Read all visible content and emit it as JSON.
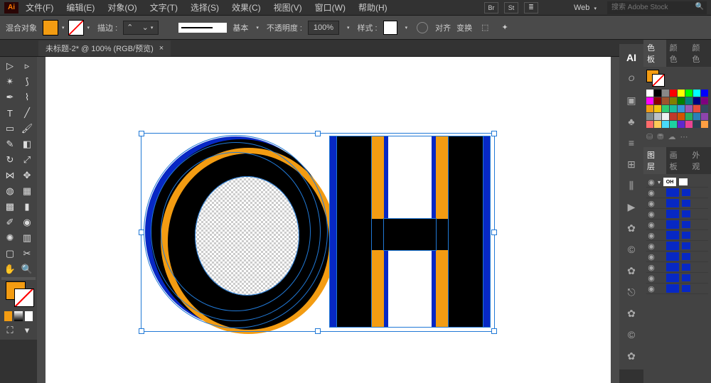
{
  "menubar": {
    "app": "Ai",
    "items": [
      "文件(F)",
      "编辑(E)",
      "对象(O)",
      "文字(T)",
      "选择(S)",
      "效果(C)",
      "视图(V)",
      "窗口(W)",
      "帮助(H)"
    ],
    "right_icons": [
      "Br",
      "St",
      "≣"
    ],
    "workspace": "Web",
    "search_placeholder": "搜索 Adobe Stock"
  },
  "controlbar": {
    "blend_label": "混合对象",
    "stroke_label": "描边 :",
    "basic_label": "基本",
    "opacity_label": "不透明度 :",
    "opacity_value": "100%",
    "style_label": "样式 :",
    "align": "对齐",
    "transform": "变换"
  },
  "document_tab": {
    "title": "未标题-2* @ 100% (RGB/预览)"
  },
  "panels": {
    "color_tabs": [
      "色板",
      "颜色",
      "颜色"
    ],
    "layer_tabs": [
      "图层",
      "画板",
      "外观"
    ],
    "layers": [
      {
        "thumb": "OH",
        "color": "#fff"
      },
      {
        "thumb": "",
        "color": "#0728c4"
      },
      {
        "thumb": "",
        "color": "#0728c4"
      },
      {
        "thumb": "",
        "color": "#0728c4"
      },
      {
        "thumb": "",
        "color": "#0728c4"
      },
      {
        "thumb": "",
        "color": "#0728c4"
      },
      {
        "thumb": "",
        "color": "#0728c4"
      },
      {
        "thumb": "",
        "color": "#0728c4"
      },
      {
        "thumb": "",
        "color": "#0728c4"
      },
      {
        "thumb": "",
        "color": "#0728c4"
      },
      {
        "thumb": "",
        "color": "#0728c4"
      }
    ]
  },
  "palette_colors": [
    "#ffffff",
    "#000000",
    "#888888",
    "#ff0000",
    "#ffff00",
    "#00ff00",
    "#00ffff",
    "#0000ff",
    "#ff00ff",
    "#8b0000",
    "#a0522d",
    "#808000",
    "#008000",
    "#008080",
    "#000080",
    "#800080",
    "#f39c12",
    "#f1c40f",
    "#2ecc71",
    "#1abc9c",
    "#3498db",
    "#9b59b6",
    "#e74c3c",
    "#34495e",
    "#7f8c8d",
    "#bdc3c7",
    "#ecf0f1",
    "#c0392b",
    "#d35400",
    "#27ae60",
    "#2980b9",
    "#8e44ad",
    "#ff6b6b",
    "#feca57",
    "#48dbfb",
    "#1dd1a1",
    "#5f27cd",
    "#e84393",
    "#2c3e50",
    "#ff9f43"
  ],
  "artwork": {
    "text": "OH",
    "colors": {
      "blue": "#0728c4",
      "orange": "#f39c12",
      "black": "#000000"
    }
  }
}
